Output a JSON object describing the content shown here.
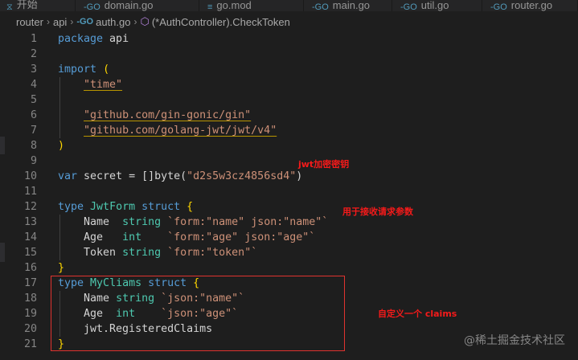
{
  "tabs": [
    {
      "label": "开始",
      "icon": "vscode-icon"
    },
    {
      "label": "domain.go",
      "icon": "go-file-icon"
    },
    {
      "label": "go.mod",
      "icon": "gomod-file-icon"
    },
    {
      "label": "main.go",
      "icon": "go-file-icon"
    },
    {
      "label": "util.go",
      "icon": "go-file-icon"
    },
    {
      "label": "router.go",
      "icon": "go-file-icon"
    }
  ],
  "breadcrumb": {
    "parts": [
      "router",
      "api",
      "auth.go",
      "(*AuthController).CheckToken"
    ],
    "file_icon": "go-file-icon",
    "method_icon": "method-cube-icon"
  },
  "code": {
    "lines": [
      {
        "n": "1",
        "segs": [
          {
            "t": "package",
            "c": "kw"
          },
          {
            "t": " api",
            "c": ""
          }
        ]
      },
      {
        "n": "2",
        "segs": []
      },
      {
        "n": "3",
        "segs": [
          {
            "t": "import",
            "c": "kw"
          },
          {
            "t": " ",
            "c": ""
          },
          {
            "t": "(",
            "c": "brk"
          }
        ]
      },
      {
        "n": "4",
        "segs": [
          {
            "t": "    ",
            "c": ""
          },
          {
            "t": "\"time\"",
            "c": "str ul"
          }
        ]
      },
      {
        "n": "5",
        "segs": []
      },
      {
        "n": "6",
        "segs": [
          {
            "t": "    ",
            "c": ""
          },
          {
            "t": "\"github.com/gin-gonic/gin\"",
            "c": "str ul"
          }
        ]
      },
      {
        "n": "7",
        "segs": [
          {
            "t": "    ",
            "c": ""
          },
          {
            "t": "\"github.com/golang-jwt/jwt/v4\"",
            "c": "str ul"
          }
        ]
      },
      {
        "n": "8",
        "segs": [
          {
            "t": ")",
            "c": "brk"
          }
        ]
      },
      {
        "n": "9",
        "segs": []
      },
      {
        "n": "10",
        "segs": [
          {
            "t": "var",
            "c": "kw"
          },
          {
            "t": " secret = []byte(",
            "c": ""
          },
          {
            "t": "\"d2s5w3cz4856sd4\"",
            "c": "str"
          },
          {
            "t": ")",
            "c": ""
          }
        ]
      },
      {
        "n": "11",
        "segs": []
      },
      {
        "n": "12",
        "segs": [
          {
            "t": "type",
            "c": "kw"
          },
          {
            "t": " ",
            "c": ""
          },
          {
            "t": "JwtForm",
            "c": "typ"
          },
          {
            "t": " ",
            "c": ""
          },
          {
            "t": "struct",
            "c": "kw"
          },
          {
            "t": " ",
            "c": ""
          },
          {
            "t": "{",
            "c": "brk"
          }
        ]
      },
      {
        "n": "13",
        "segs": [
          {
            "t": "    Name  ",
            "c": ""
          },
          {
            "t": "string",
            "c": "typ"
          },
          {
            "t": " ",
            "c": ""
          },
          {
            "t": "`form:\"name\" json:\"name\"`",
            "c": "str"
          }
        ]
      },
      {
        "n": "14",
        "segs": [
          {
            "t": "    Age   ",
            "c": ""
          },
          {
            "t": "int",
            "c": "typ"
          },
          {
            "t": "    ",
            "c": ""
          },
          {
            "t": "`form:\"age\" json:\"age\"`",
            "c": "str"
          }
        ]
      },
      {
        "n": "15",
        "segs": [
          {
            "t": "    Token ",
            "c": ""
          },
          {
            "t": "string",
            "c": "typ"
          },
          {
            "t": " ",
            "c": ""
          },
          {
            "t": "`form:\"token\"`",
            "c": "str"
          }
        ]
      },
      {
        "n": "16",
        "segs": [
          {
            "t": "}",
            "c": "brk"
          }
        ]
      },
      {
        "n": "17",
        "segs": [
          {
            "t": "type",
            "c": "kw"
          },
          {
            "t": " ",
            "c": ""
          },
          {
            "t": "MyCliams",
            "c": "typ"
          },
          {
            "t": " ",
            "c": ""
          },
          {
            "t": "struct",
            "c": "kw"
          },
          {
            "t": " ",
            "c": ""
          },
          {
            "t": "{",
            "c": "brk"
          }
        ]
      },
      {
        "n": "18",
        "segs": [
          {
            "t": "    Name ",
            "c": ""
          },
          {
            "t": "string",
            "c": "typ"
          },
          {
            "t": " ",
            "c": ""
          },
          {
            "t": "`json:\"name\"`",
            "c": "str"
          }
        ]
      },
      {
        "n": "19",
        "segs": [
          {
            "t": "    Age  ",
            "c": ""
          },
          {
            "t": "int",
            "c": "typ"
          },
          {
            "t": "    ",
            "c": ""
          },
          {
            "t": "`json:\"age\"`",
            "c": "str"
          }
        ]
      },
      {
        "n": "20",
        "segs": [
          {
            "t": "    jwt.RegisteredClaims",
            "c": ""
          }
        ]
      },
      {
        "n": "21",
        "segs": [
          {
            "t": "}",
            "c": "brk"
          }
        ]
      }
    ]
  },
  "annotations": {
    "secret_note": "jwt加密密钥",
    "form_note": "用于接收请求参数",
    "claims_note": "自定义一个 claims"
  },
  "watermark": "@稀土掘金技术社区",
  "colors": {
    "editor_bg": "#1e1e1e",
    "keyword": "#569cd6",
    "string": "#ce9178",
    "type": "#4ec9b0",
    "bracket": "#ffd700",
    "annotation": "#f51a1a",
    "highlight_box": "#e0332f"
  }
}
